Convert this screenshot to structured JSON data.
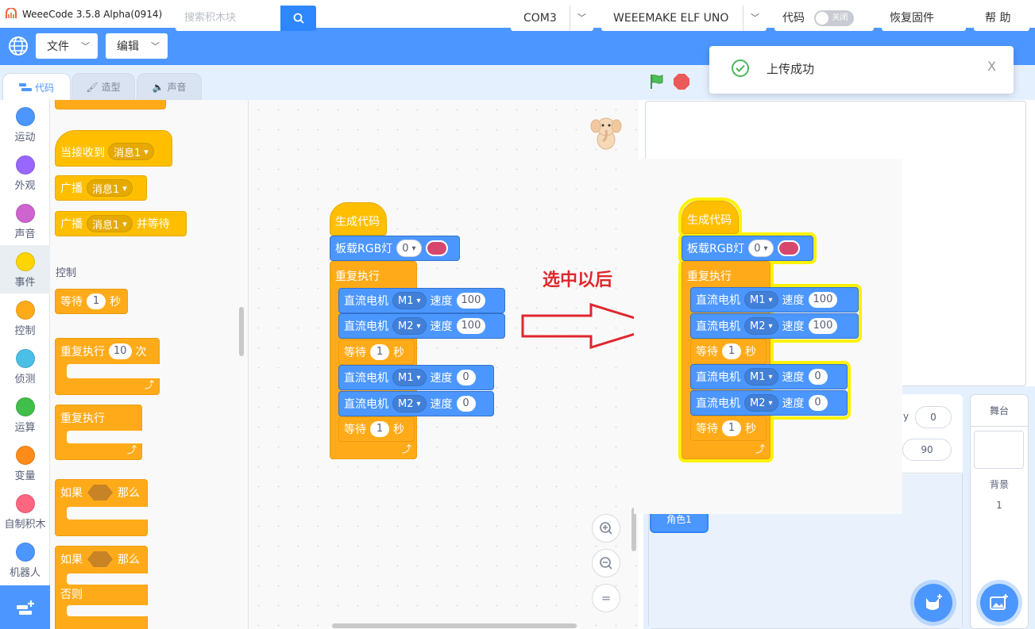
{
  "window": {
    "title": "WeeeCode 3.5.8 Alpha(0914)",
    "minimize": "—",
    "maximize": "☐",
    "close": "✕"
  },
  "menubar": {
    "file": "文件",
    "edit": "编辑",
    "search_placeholder": "搜索积木块",
    "port": "COM3",
    "board": "WEEEMAKE ELF UNO",
    "code_btn": "代码",
    "toggle_off": "关闭",
    "restore_firmware": "恢复固件",
    "help": "帮 助"
  },
  "toast": {
    "message": "上传成功",
    "close": "X"
  },
  "tabs": {
    "code": "代码",
    "costume": "造型",
    "sound": "声音"
  },
  "categories": [
    {
      "label": "运动",
      "color": "#4c97ff"
    },
    {
      "label": "外观",
      "color": "#9966ff"
    },
    {
      "label": "声音",
      "color": "#cf63cf"
    },
    {
      "label": "事件",
      "color": "#ffd500"
    },
    {
      "label": "控制",
      "color": "#ffab19"
    },
    {
      "label": "侦测",
      "color": "#4cbfe6"
    },
    {
      "label": "运算",
      "color": "#40bf4a"
    },
    {
      "label": "变量",
      "color": "#ff8c1a"
    },
    {
      "label": "自制积木",
      "color": "#ff6680"
    },
    {
      "label": "机器人",
      "color": "#4c97ff"
    }
  ],
  "flyout": {
    "when_receive": "当接收到",
    "msg1": "消息1",
    "broadcast": "广播",
    "broadcast_wait_suffix": "并等待",
    "control_section": "控制",
    "wait": "等待",
    "wait_value": "1",
    "seconds": "秒",
    "repeat": "重复执行",
    "repeat_count": "10",
    "times": "次",
    "forever": "重复执行",
    "if": "如果",
    "then": "那么",
    "else": "否则"
  },
  "script": {
    "hat": "生成代码",
    "rgb": "板载RGB灯",
    "rgb_index": "0",
    "forever": "重复执行",
    "motor": "直流电机",
    "speed": "速度",
    "m1": "M1",
    "m2": "M2",
    "speed_100": "100",
    "speed_0": "0",
    "wait": "等待",
    "wait_value": "1",
    "seconds": "秒"
  },
  "annotation": {
    "label": "选中以后",
    "color": "#e0262d"
  },
  "sprite_info": {
    "y_label": "y",
    "y_value": "0",
    "direction_value": "90"
  },
  "sprite_list": {
    "sprite_name": "角色1"
  },
  "stage_pane": {
    "title": "舞台",
    "backdrop_label": "背景",
    "backdrop_count": "1"
  }
}
